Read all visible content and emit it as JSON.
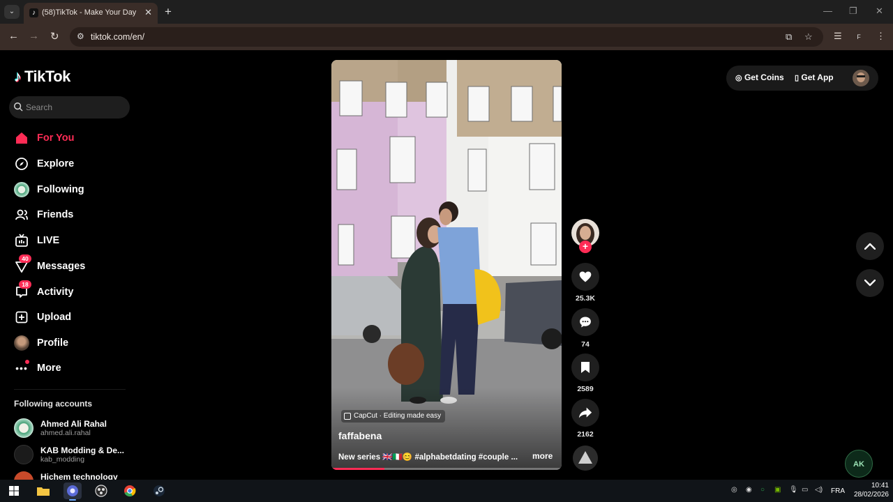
{
  "browser": {
    "tab_title": "(58)TikTok - Make Your Day",
    "url": "tiktok.com/en/",
    "profile_initial": "F"
  },
  "sidebar": {
    "logo": "TikTok",
    "search_placeholder": "Search",
    "items": [
      {
        "label": "For You",
        "icon": "home-icon",
        "active": true
      },
      {
        "label": "Explore",
        "icon": "compass-icon"
      },
      {
        "label": "Following",
        "icon": "following-avatar"
      },
      {
        "label": "Friends",
        "icon": "friends-icon"
      },
      {
        "label": "LIVE",
        "icon": "live-icon"
      },
      {
        "label": "Messages",
        "icon": "messages-icon",
        "badge": "40"
      },
      {
        "label": "Activity",
        "icon": "activity-icon",
        "badge": "18"
      },
      {
        "label": "Upload",
        "icon": "upload-icon"
      },
      {
        "label": "Profile",
        "icon": "profile-avatar"
      },
      {
        "label": "More",
        "icon": "more-icon"
      }
    ],
    "following_title": "Following accounts",
    "accounts": [
      {
        "name": "Ahmed Ali Rahal",
        "handle": "ahmed.ali.rahal"
      },
      {
        "name": "KAB Modding & De...",
        "handle": "kab_modding"
      },
      {
        "name": "Hichem technology",
        "handle": ""
      }
    ]
  },
  "video": {
    "effect_label": "CapCut · Editing made easy",
    "author": "faffabena",
    "description": "New series 🇬🇧🇮🇹😊 #alphabetdating #couple ...",
    "more": "more",
    "progress": 0.23
  },
  "rail": {
    "likes": "25.3K",
    "comments": "74",
    "saves": "2589",
    "shares": "2162"
  },
  "top_actions": {
    "coins": "Get Coins",
    "app": "Get App"
  },
  "taskbar": {
    "lang": "FRA",
    "time": "10:41",
    "date": "28/02/2026"
  },
  "colors": {
    "accent": "#fe2c55",
    "chrome_toolbar": "#3a2d28",
    "background": "#000000"
  }
}
